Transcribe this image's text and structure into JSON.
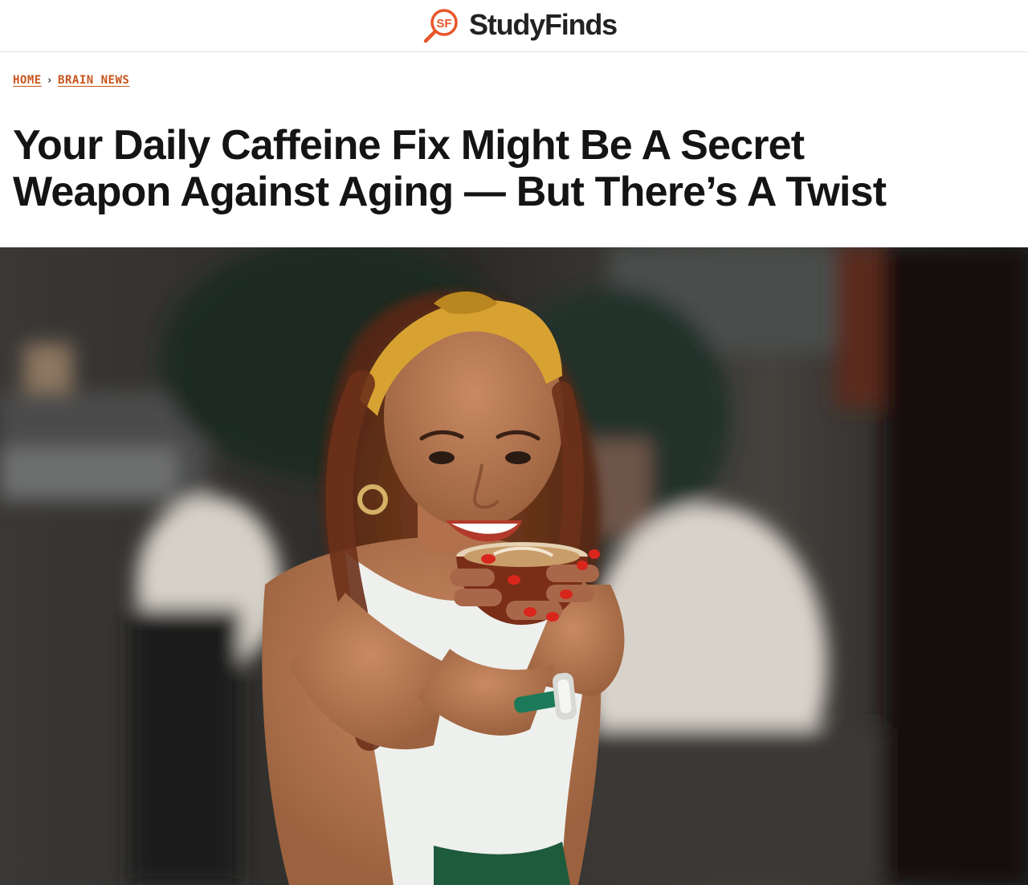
{
  "site": {
    "logo_text": "SF",
    "name": "StudyFinds",
    "brand_color": "#e8562a"
  },
  "breadcrumb": {
    "home_label": "HOME",
    "separator": "›",
    "category_label": "BRAIN NEWS"
  },
  "article": {
    "title_line1": "Your Daily Caffeine Fix Might Be A Secret",
    "title_line2": "Weapon Against Aging — But There’s A Twist"
  },
  "hero_image": {
    "subject": "smiling woman with yellow headband holding a latte cup in a cafe"
  }
}
